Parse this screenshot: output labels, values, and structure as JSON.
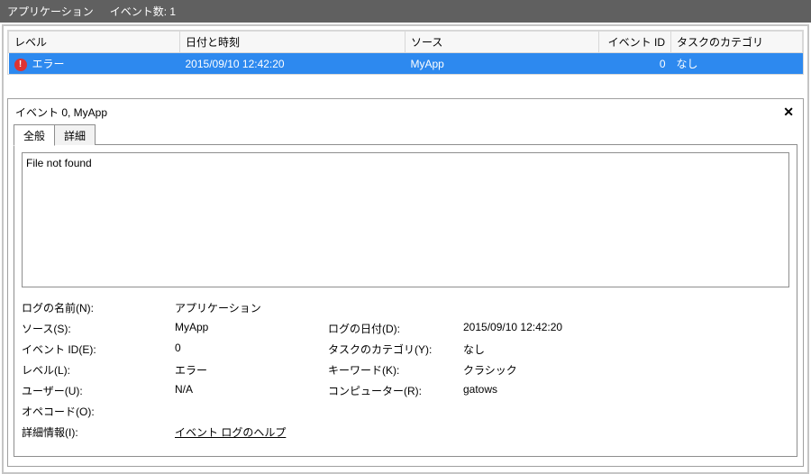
{
  "header": {
    "title": "アプリケーション",
    "count_label": "イベント数: 1"
  },
  "table": {
    "columns": {
      "level": "レベル",
      "datetime": "日付と時刻",
      "source": "ソース",
      "event_id": "イベント ID",
      "task_category": "タスクのカテゴリ"
    },
    "row": {
      "level": "エラー",
      "datetime": "2015/09/10 12:42:20",
      "source": "MyApp",
      "event_id": "0",
      "task_category": "なし"
    }
  },
  "detail": {
    "title": "イベント 0, MyApp",
    "tabs": {
      "general": "全般",
      "details": "詳細"
    },
    "message": "File not found",
    "meta_labels": {
      "log_name": "ログの名前(N):",
      "source": "ソース(S):",
      "event_id": "イベント ID(E):",
      "level": "レベル(L):",
      "user": "ユーザー(U):",
      "opcode": "オペコード(O):",
      "more_info": "詳細情報(I):",
      "log_date": "ログの日付(D):",
      "task_category": "タスクのカテゴリ(Y):",
      "keyword": "キーワード(K):",
      "computer": "コンピューター(R):"
    },
    "meta_values": {
      "log_name": "アプリケーション",
      "source": "MyApp",
      "event_id": "0",
      "level": "エラー",
      "user": "N/A",
      "opcode": "",
      "more_info": "イベント ログのヘルプ",
      "log_date": "2015/09/10 12:42:20",
      "task_category": "なし",
      "keyword": "クラシック",
      "computer": "gatows"
    }
  }
}
